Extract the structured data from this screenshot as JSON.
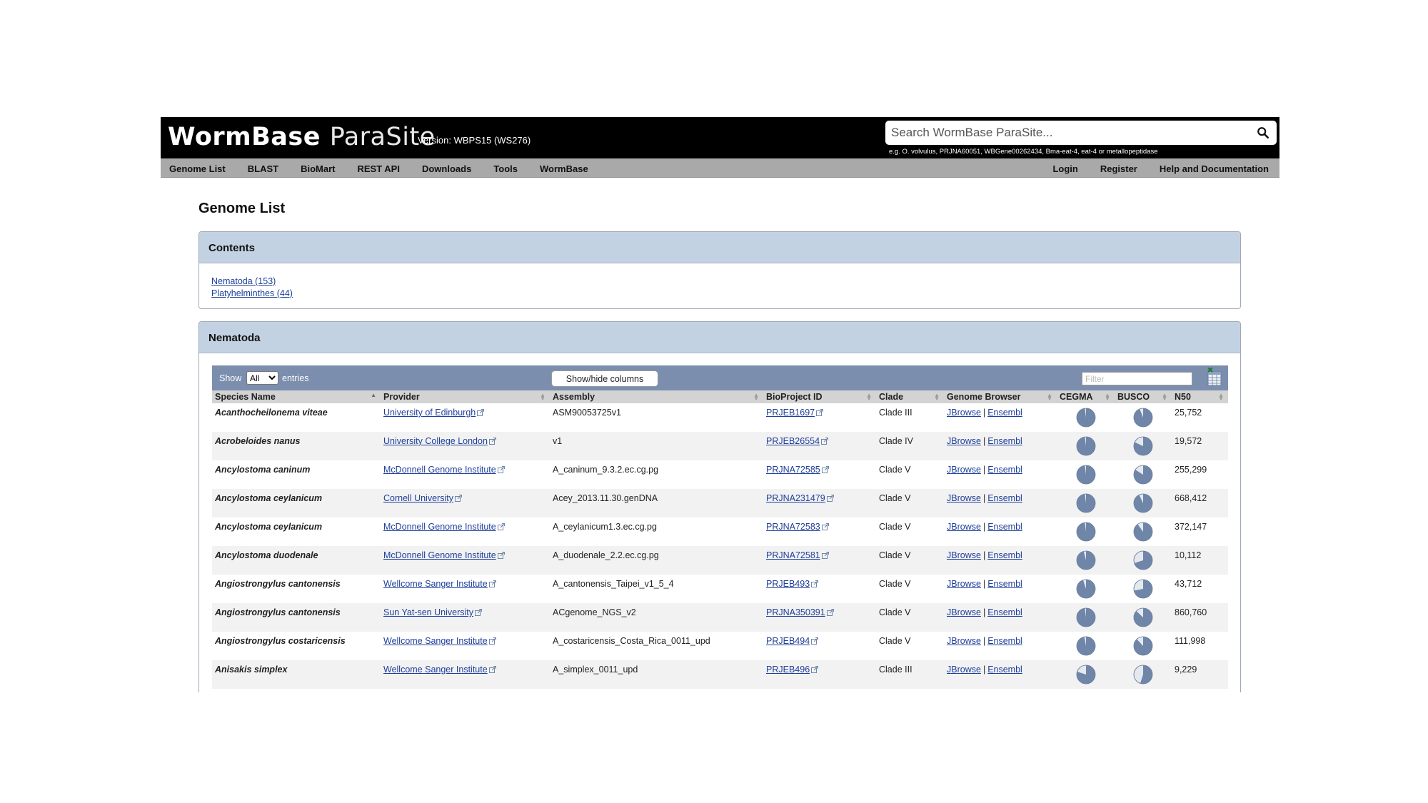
{
  "header": {
    "logo_text": "WormBase ParaSite",
    "logo_bold": "WormBase",
    "logo_light": "ParaSite",
    "version": "Version: WBPS15 (WS276)",
    "search_placeholder": "Search WormBase ParaSite...",
    "search_example": "e.g. O. volvulus, PRJNA60051, WBGene00262434, Bma-eat-4, eat-4 or metallopeptidase"
  },
  "nav": {
    "left": [
      "Genome List",
      "BLAST",
      "BioMart",
      "REST API",
      "Downloads",
      "Tools",
      "WormBase"
    ],
    "right": [
      "Login",
      "Register",
      "Help and Documentation"
    ]
  },
  "page_title": "Genome List",
  "contents": {
    "title": "Contents",
    "links": [
      "Nematoda (153)",
      "Platyhelminthes (44)"
    ]
  },
  "nematoda": {
    "title": "Nematoda",
    "show_label": "Show",
    "show_value": "All",
    "entries_label": "entries",
    "colvis_label": "Show/hide columns",
    "filter_placeholder": "Filter",
    "columns": [
      "Species Name",
      "Provider",
      "Assembly",
      "BioProject ID",
      "Clade",
      "Genome Browser",
      "CEGMA",
      "BUSCO",
      "N50"
    ],
    "browser_links": [
      "JBrowse",
      "Ensembl"
    ],
    "browser_sep": "|",
    "rows": [
      {
        "species": "Acanthocheilonema viteae",
        "provider": "University of Edinburgh",
        "assembly": "ASM90053725v1",
        "bioproject": "PRJEB1697",
        "clade": "Clade III",
        "cegma": 0.98,
        "busco": 0.94,
        "n50": "25,752"
      },
      {
        "species": "Acrobeloides nanus",
        "provider": "University College London",
        "assembly": "v1",
        "bioproject": "PRJEB26554",
        "clade": "Clade IV",
        "cegma": 0.98,
        "busco": 0.82,
        "n50": "19,572"
      },
      {
        "species": "Ancylostoma caninum",
        "provider": "McDonnell Genome Institute",
        "assembly": "A_caninum_9.3.2.ec.cg.pg",
        "bioproject": "PRJNA72585",
        "clade": "Clade V",
        "cegma": 0.98,
        "busco": 0.84,
        "n50": "255,299"
      },
      {
        "species": "Ancylostoma ceylanicum",
        "provider": "Cornell University",
        "assembly": "Acey_2013.11.30.genDNA",
        "bioproject": "PRJNA231479",
        "clade": "Clade V",
        "cegma": 0.98,
        "busco": 0.93,
        "n50": "668,412"
      },
      {
        "species": "Ancylostoma ceylanicum",
        "provider": "McDonnell Genome Institute",
        "assembly": "A_ceylanicum1.3.ec.cg.pg",
        "bioproject": "PRJNA72583",
        "clade": "Clade V",
        "cegma": 0.98,
        "busco": 0.9,
        "n50": "372,147"
      },
      {
        "species": "Ancylostoma duodenale",
        "provider": "McDonnell Genome Institute",
        "assembly": "A_duodenale_2.2.ec.cg.pg",
        "bioproject": "PRJNA72581",
        "clade": "Clade V",
        "cegma": 0.96,
        "busco": 0.7,
        "n50": "10,112"
      },
      {
        "species": "Angiostrongylus cantonensis",
        "provider": "Wellcome Sanger Institute",
        "assembly": "A_cantonensis_Taipei_v1_5_4",
        "bioproject": "PRJEB493",
        "clade": "Clade V",
        "cegma": 0.95,
        "busco": 0.72,
        "n50": "43,712"
      },
      {
        "species": "Angiostrongylus cantonensis",
        "provider": "Sun Yat-sen University",
        "assembly": "ACgenome_NGS_v2",
        "bioproject": "PRJNA350391",
        "clade": "Clade V",
        "cegma": 0.98,
        "busco": 0.87,
        "n50": "860,760"
      },
      {
        "species": "Angiostrongylus costaricensis",
        "provider": "Wellcome Sanger Institute",
        "assembly": "A_costaricensis_Costa_Rica_0011_upd",
        "bioproject": "PRJEB494",
        "clade": "Clade V",
        "cegma": 0.97,
        "busco": 0.88,
        "n50": "111,998"
      },
      {
        "species": "Anisakis simplex",
        "provider": "Wellcome Sanger Institute",
        "assembly": "A_simplex_0011_upd",
        "bioproject": "PRJEB496",
        "clade": "Clade III",
        "cegma": 0.8,
        "busco": 0.55,
        "n50": "9,229"
      }
    ]
  },
  "colors": {
    "header_bg": "#000000",
    "nav_bg": "#a9a9a9",
    "panel_header_bg": "#c3d2e2",
    "toolbar_bg": "#7b8eae",
    "link": "#1f3f9a",
    "pie_fill": "#6f86a8",
    "pie_rest": "#e4e9ef"
  }
}
